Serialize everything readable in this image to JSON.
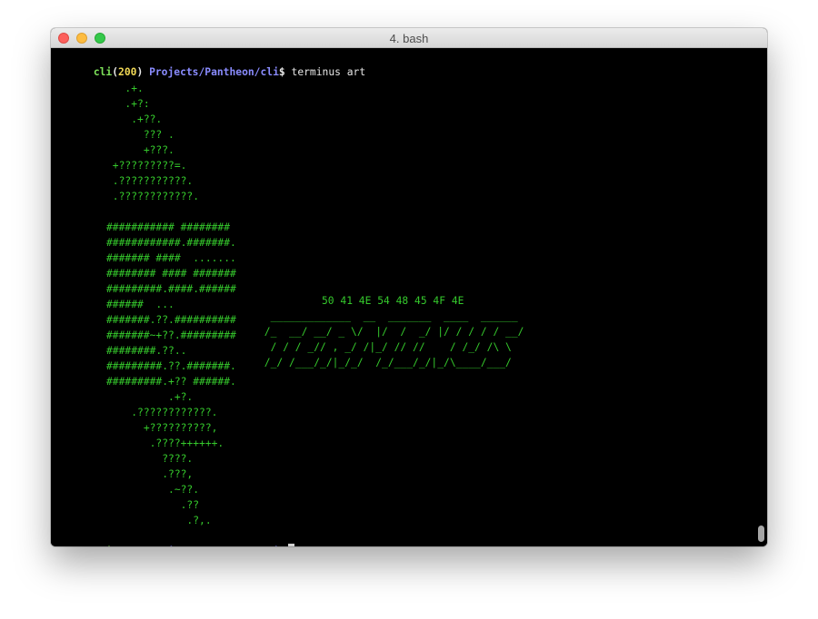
{
  "window": {
    "title": "4. bash"
  },
  "prompt": {
    "user": "cli",
    "open_paren": "(",
    "status": "200",
    "close_paren": ")",
    "path": "Projects/Pantheon/cli",
    "symbol": "$"
  },
  "command": "terminus art",
  "logo_lines": [
    "        .+.",
    "        .+?:",
    "         .+??.",
    "           ??? .",
    "           +???.",
    "      +?????????=.",
    "      .???????????.",
    "      .????????????.",
    "",
    "     ########### ########",
    "     ############.#######.",
    "     ####### ####  .......",
    "     ######## #### #######",
    "     #########.####.######",
    "     ######  ...",
    "     #######.??.##########",
    "     #######~+??.#########",
    "     ########.??..",
    "     #########.??.#######.",
    "     #########.+?? ######.",
    "               .+?.",
    "         .????????????.",
    "           +??????????,",
    "            .????++++++.",
    "              ????.",
    "              .???,",
    "               .~??.",
    "                 .??",
    "                  .?,."
  ],
  "banner_hex": "50 41 4E 54 48 45 4F 4E",
  "banner_lines": [
    "  _____________  __  _______  ____  ______",
    " /_  __/ __/ _ \\/  |/  /  _/ |/ / / / / __/",
    "  / / / _// , _/ /|_/ // //    / /_/ /\\ \\",
    " /_/ /___/_/|_/_/  /_/___/_/|_/\\____/___/"
  ],
  "colors": {
    "terminal_bg": "#000000",
    "art_green": "#35c92c",
    "prompt_user": "#7ee35a",
    "prompt_status": "#f0d855",
    "prompt_path": "#8a8cff"
  }
}
